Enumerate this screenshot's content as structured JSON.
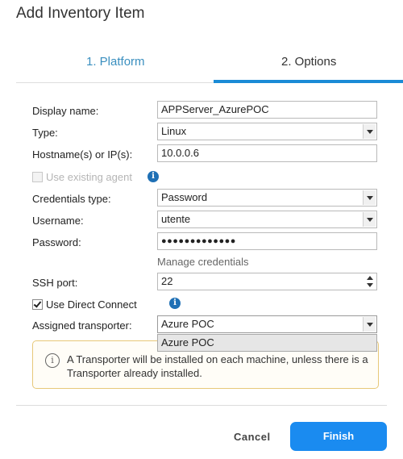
{
  "dialog": {
    "title": "Add Inventory Item"
  },
  "tabs": [
    {
      "label": "1. Platform",
      "active": false
    },
    {
      "label": "2. Options",
      "active": true
    }
  ],
  "form": {
    "display_name": {
      "label": "Display name:",
      "value": "APPServer_AzurePOC"
    },
    "type": {
      "label": "Type:",
      "value": "Linux"
    },
    "hostname": {
      "label": "Hostname(s) or IP(s):",
      "value": "10.0.0.6"
    },
    "use_existing_agent": {
      "label": "Use existing agent",
      "checked": false,
      "enabled": false
    },
    "credentials_type": {
      "label": "Credentials type:",
      "value": "Password"
    },
    "username": {
      "label": "Username:",
      "value": "utente"
    },
    "password": {
      "label": "Password:",
      "value": "●●●●●●●●●●●●●"
    },
    "manage_credentials": "Manage credentials",
    "ssh_port": {
      "label": "SSH port:",
      "value": "22"
    },
    "use_direct_connect": {
      "label": "Use Direct Connect",
      "checked": true
    },
    "assigned_transporter": {
      "label": "Assigned transporter:",
      "value": "Azure POC",
      "options": [
        "Azure POC"
      ]
    }
  },
  "notice": {
    "text_before": "A ",
    "link": "Transporter",
    "text_after": " will be installed on each machine, unless there is a Transporter already installed."
  },
  "buttons": {
    "cancel": "Cancel",
    "finish": "Finish"
  },
  "colors": {
    "accent": "#1a8bf0",
    "tab_active_underline": "#1a8bd6",
    "notice_border": "#e7c878"
  }
}
